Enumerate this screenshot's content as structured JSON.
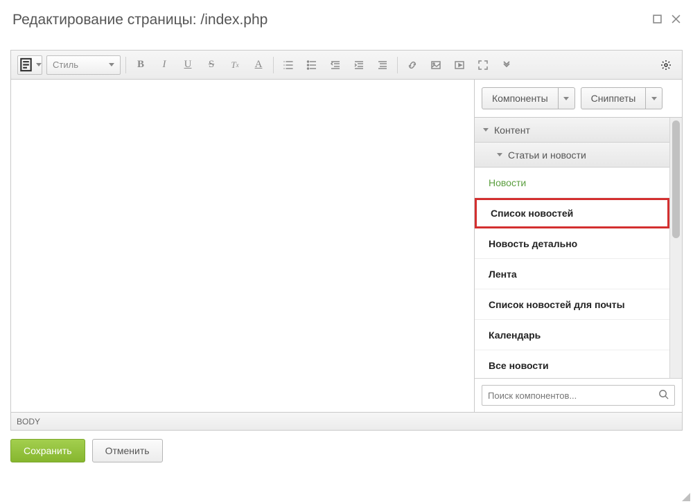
{
  "window": {
    "title": "Редактирование страницы: /index.php"
  },
  "toolbar": {
    "style_placeholder": "Стиль"
  },
  "side": {
    "tab_components": "Компоненты",
    "tab_snippets": "Сниппеты",
    "section_content": "Контент",
    "section_articles": "Статьи и новости",
    "items": [
      {
        "label": "Новости",
        "green": true
      },
      {
        "label": "Список новостей",
        "highlight": true
      },
      {
        "label": "Новость детально"
      },
      {
        "label": "Лента"
      },
      {
        "label": "Список новостей для почты"
      },
      {
        "label": "Календарь"
      },
      {
        "label": "Все новости"
      }
    ],
    "search_placeholder": "Поиск компонентов..."
  },
  "status": {
    "path": "BODY"
  },
  "footer": {
    "save": "Сохранить",
    "cancel": "Отменить"
  }
}
